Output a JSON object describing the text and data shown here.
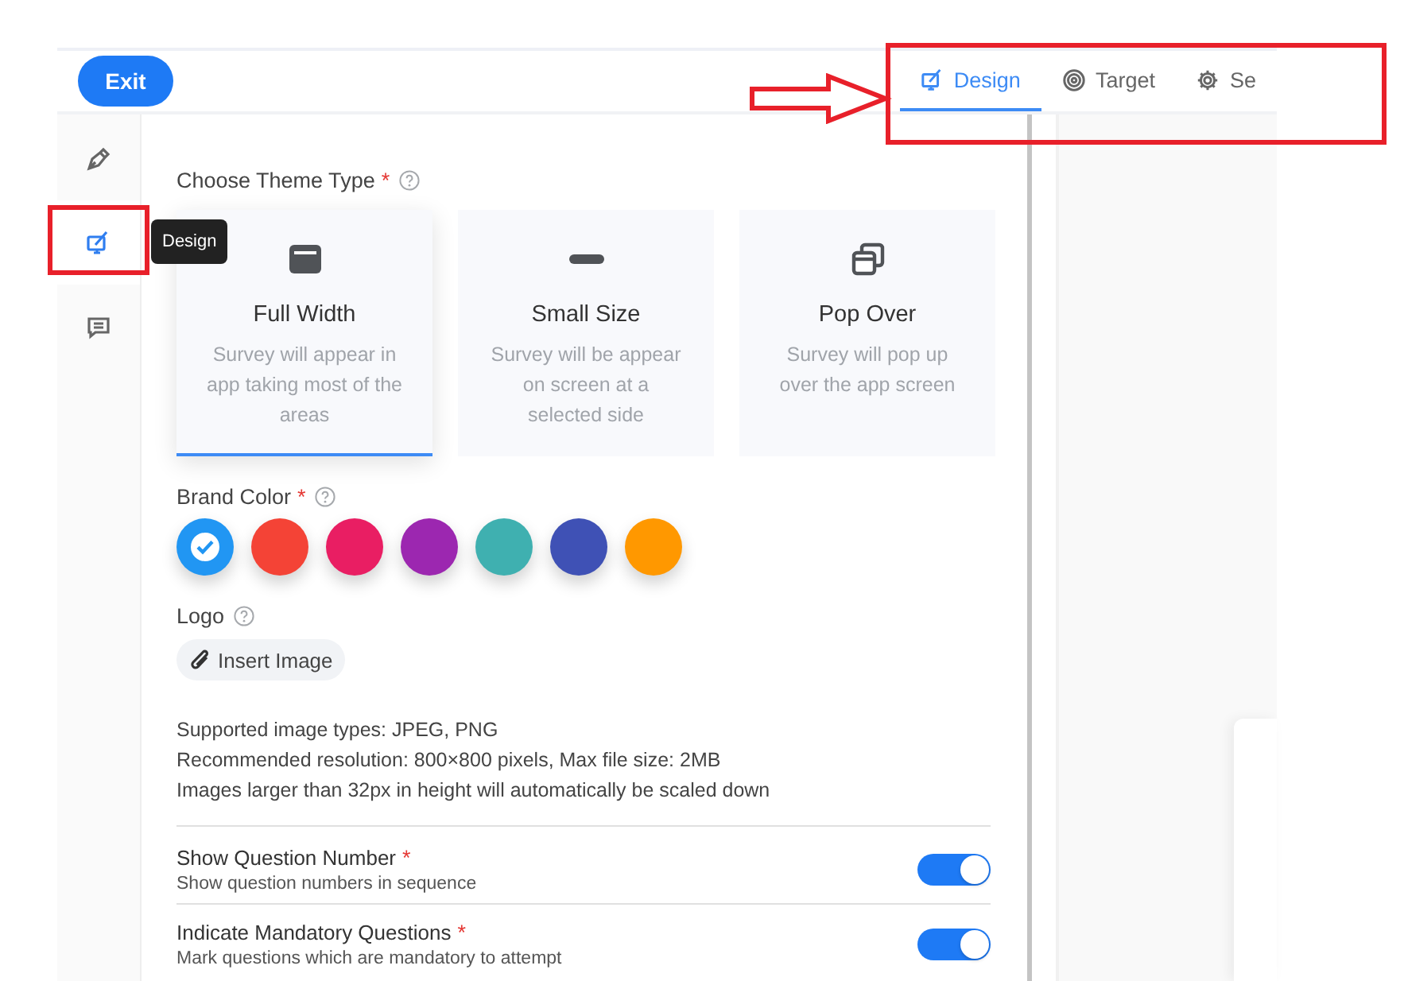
{
  "exit_button": "Exit",
  "tabs": [
    {
      "label": "Design",
      "kind": "design",
      "selected": true
    },
    {
      "label": "Target",
      "kind": "target",
      "selected": false
    },
    {
      "label": "Se",
      "kind": "gear",
      "selected": false
    }
  ],
  "sidebar": {
    "items": [
      {
        "kind": "pen",
        "selected": false
      },
      {
        "kind": "design",
        "selected": true
      },
      {
        "kind": "chat",
        "selected": false
      }
    ],
    "tooltip": "Design"
  },
  "theme_type": {
    "label": "Choose Theme Type",
    "required_mark": "*",
    "options": [
      {
        "kind": "full",
        "title": "Full Width",
        "description": "Survey will appear in app taking most of the areas",
        "selected": true
      },
      {
        "kind": "small",
        "title": "Small Size",
        "description": "Survey will be appear on screen at a selected side",
        "selected": false
      },
      {
        "kind": "popover",
        "title": "Pop Over",
        "description": "Survey will pop up over the app screen",
        "selected": false
      }
    ]
  },
  "brand_color": {
    "label": "Brand Color",
    "required_mark": "*",
    "colors": [
      {
        "color": "#2196f3",
        "selected": true
      },
      {
        "color": "#f44336",
        "selected": false
      },
      {
        "color": "#e91e63",
        "selected": false
      },
      {
        "color": "#9c27b0",
        "selected": false
      },
      {
        "color": "#3fb0b0",
        "selected": false
      },
      {
        "color": "#3f51b5",
        "selected": false
      },
      {
        "color": "#ff9800",
        "selected": false
      }
    ]
  },
  "logo": {
    "label": "Logo",
    "button": "Insert Image",
    "notes": [
      "Supported image types: JPEG, PNG",
      "Recommended resolution: 800×800 pixels, Max file size: 2MB",
      "Images larger than 32px in height will automatically be scaled down"
    ]
  },
  "settings": [
    {
      "title": "Show Question Number",
      "required_mark": "*",
      "description": "Show question numbers in sequence",
      "on": true
    },
    {
      "title": "Indicate Mandatory Questions",
      "required_mark": "*",
      "description": "Mark questions which are mandatory to attempt",
      "on": true
    }
  ]
}
